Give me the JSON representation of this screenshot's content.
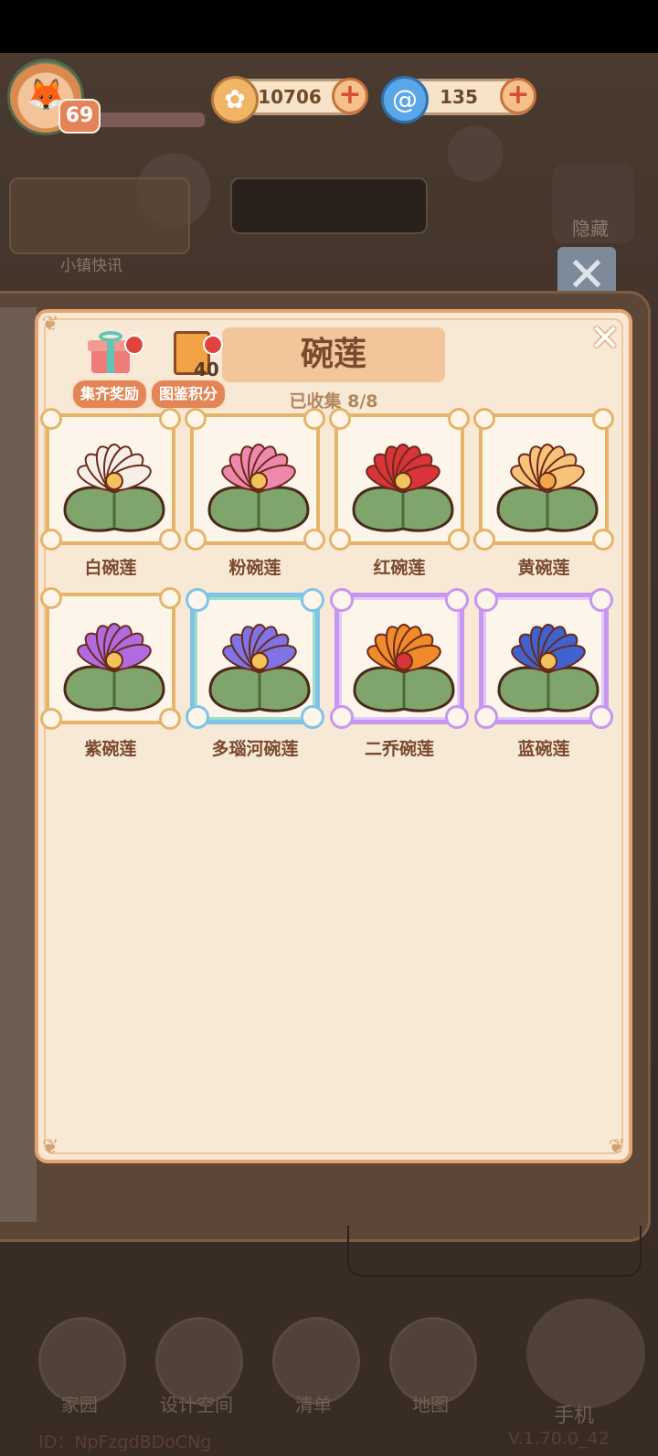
{
  "hud": {
    "level": "69",
    "coins": "10706",
    "gems": "135",
    "news_label": "小镇快讯",
    "hide_label": "隐藏"
  },
  "panel": {
    "title": "碗莲",
    "collected": "已收集 8/8",
    "reward_label": "集齐奖励",
    "points_label": "图鉴积分",
    "points_value": "40"
  },
  "items": [
    {
      "name": "白碗莲",
      "petal": "#f6efe8",
      "center": "#f1c35a",
      "frame": "gold"
    },
    {
      "name": "粉碗莲",
      "petal": "#ef88ad",
      "center": "#f1c35a",
      "frame": "gold"
    },
    {
      "name": "红碗莲",
      "petal": "#d8343a",
      "center": "#f1c35a",
      "frame": "gold"
    },
    {
      "name": "黄碗莲",
      "petal": "#f7c27a",
      "center": "#f1a64a",
      "frame": "gold"
    },
    {
      "name": "紫碗莲",
      "petal": "#b06be0",
      "center": "#f1c35a",
      "frame": "gold"
    },
    {
      "name": "多瑙河碗莲",
      "petal": "#7e74e6",
      "center": "#f1c35a",
      "frame": "blue"
    },
    {
      "name": "二乔碗莲",
      "petal": "#f08a2a",
      "center": "#d8343a",
      "frame": "purple"
    },
    {
      "name": "蓝碗莲",
      "petal": "#3f62cf",
      "center": "#f1c35a",
      "frame": "purple"
    }
  ],
  "nav": {
    "home": "家园",
    "design": "设计空间",
    "list": "清单",
    "map": "地图",
    "phone": "手机"
  },
  "footer": {
    "id": "ID：NpFzgdBDoCNg",
    "version": "V.1.70.0_42"
  }
}
